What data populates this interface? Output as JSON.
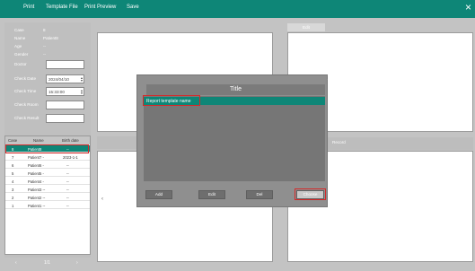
{
  "toolbar": {
    "print": "Print",
    "template_file": "Template File",
    "print_preview": "Print Preview",
    "save": "Save",
    "close": "×"
  },
  "patient_info": {
    "case_label": "Case",
    "case_value": "8",
    "name_label": "Name",
    "name_value": "Patient8",
    "age_label": "Age",
    "age_value": "--",
    "gender_label": "Gender",
    "gender_value": "--",
    "doctor_label": "Doctor",
    "doctor_value": "",
    "check_date_label": "Check Date",
    "check_date_value": "2024/04/10",
    "check_time_label": "Check Time",
    "check_time_value": "15:33:00",
    "check_room_label": "Check Room",
    "check_room_value": "",
    "check_result_label": "Check Result",
    "check_result_value": ""
  },
  "patient_list": {
    "headers": [
      "Case",
      "Name",
      "Birth date"
    ],
    "rows": [
      {
        "case": "8",
        "name": "Patient8",
        "birth": "--"
      },
      {
        "case": "7",
        "name": "Patient7 -",
        "birth": "2023-1-1"
      },
      {
        "case": "6",
        "name": "Patient6 -",
        "birth": "--"
      },
      {
        "case": "5",
        "name": "Patient5 -",
        "birth": "--"
      },
      {
        "case": "4",
        "name": "Patient4 -",
        "birth": "--"
      },
      {
        "case": "3",
        "name": "Patient3 --",
        "birth": "--"
      },
      {
        "case": "2",
        "name": "Patient2 --",
        "birth": "--"
      },
      {
        "case": "1",
        "name": "Patient1 --",
        "birth": "--"
      }
    ]
  },
  "pager": {
    "prev": "‹",
    "page": "1/1",
    "next": "›"
  },
  "editor": {
    "edit_button": "Edit",
    "record_label": "Record",
    "side_arrow": "‹"
  },
  "dialog": {
    "title": "Title",
    "close": "×",
    "selected_item": "Report template name",
    "add": "Add",
    "edit": "Edit",
    "del": "Del",
    "choose": "Choose"
  },
  "colors": {
    "accent": "#0e8677",
    "highlight": "#d42a2a"
  }
}
